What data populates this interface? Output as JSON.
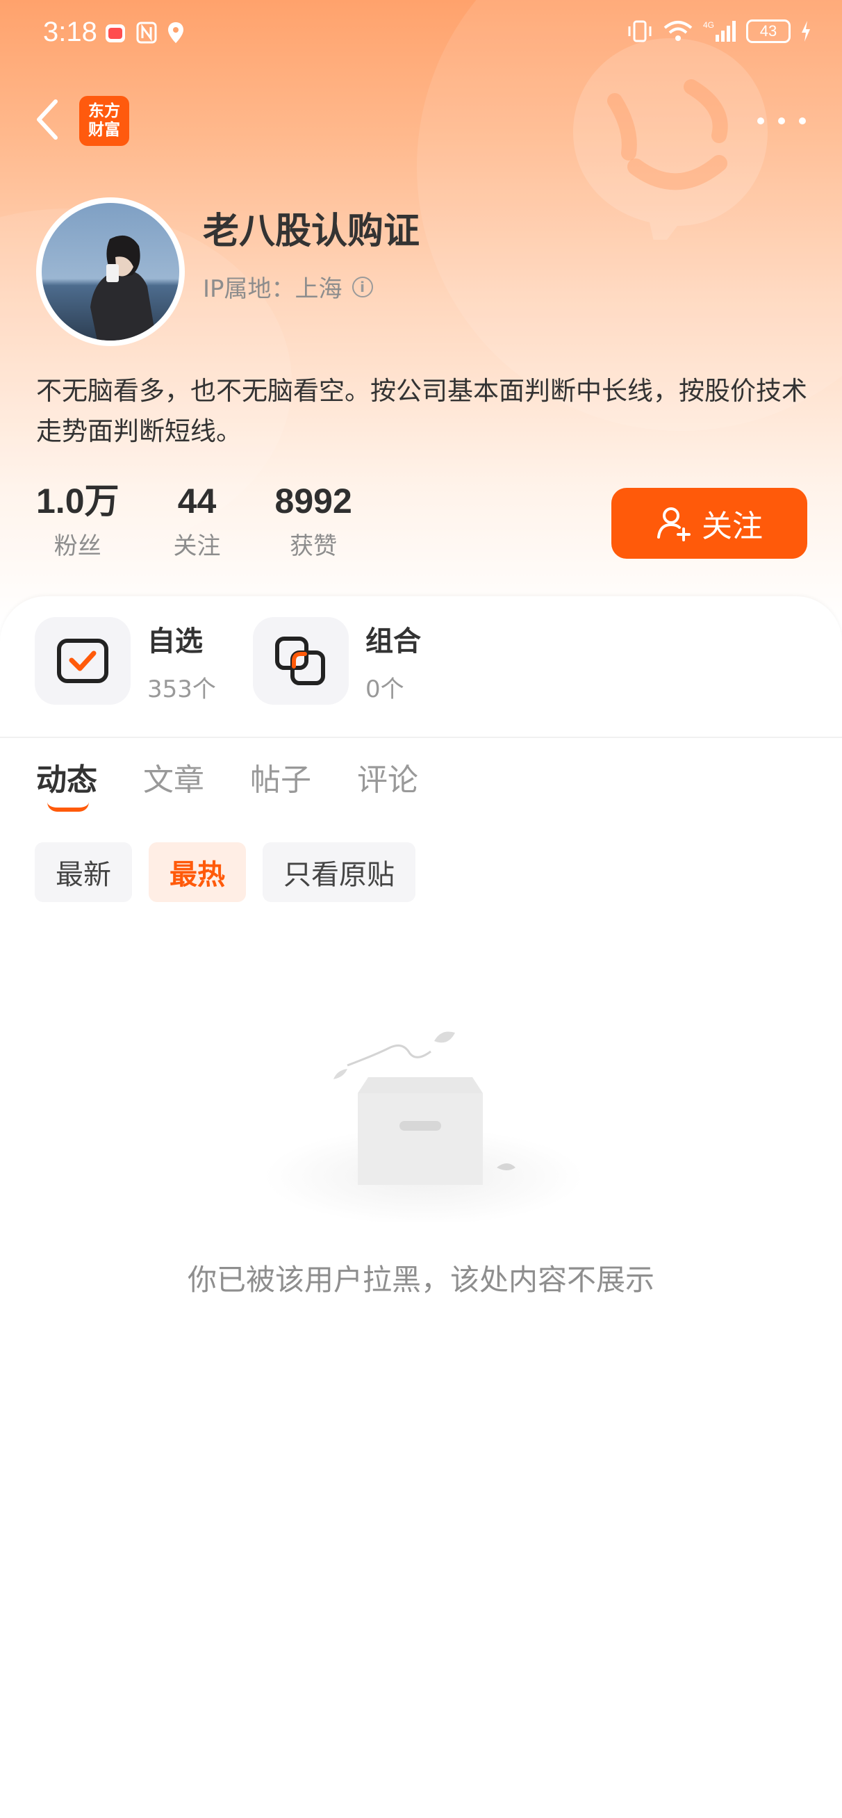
{
  "status_bar": {
    "time": "3:18",
    "battery": "43",
    "icons": [
      "app-notification-icon",
      "nfc-icon",
      "location-icon",
      "vibrate-icon",
      "wifi-icon",
      "signal-4g-icon",
      "battery-icon",
      "charging-icon"
    ]
  },
  "nav": {
    "logo_line1": "东方",
    "logo_line2": "财富"
  },
  "profile": {
    "username": "老八股认购证",
    "ip_location": "IP属地：上海",
    "bio": "不无脑看多，也不无脑看空。按公司基本面判断中长线，按股价技术走势面判断短线。",
    "stats": [
      {
        "value": "1.0万",
        "label": "粉丝"
      },
      {
        "value": "44",
        "label": "关注"
      },
      {
        "value": "8992",
        "label": "获赞"
      }
    ],
    "follow_label": "关注"
  },
  "features": [
    {
      "title": "自选",
      "sub": "353个"
    },
    {
      "title": "组合",
      "sub": "0个"
    }
  ],
  "tabs": [
    {
      "label": "动态",
      "active": true
    },
    {
      "label": "文章",
      "active": false
    },
    {
      "label": "帖子",
      "active": false
    },
    {
      "label": "评论",
      "active": false
    }
  ],
  "filters": [
    {
      "label": "最新",
      "active": false
    },
    {
      "label": "最热",
      "active": true
    },
    {
      "label": "只看原贴",
      "active": false
    }
  ],
  "empty_message": "你已被该用户拉黑，该处内容不展示",
  "colors": {
    "accent": "#ff5a0a",
    "header_gradient_top": "#ffa26c"
  }
}
